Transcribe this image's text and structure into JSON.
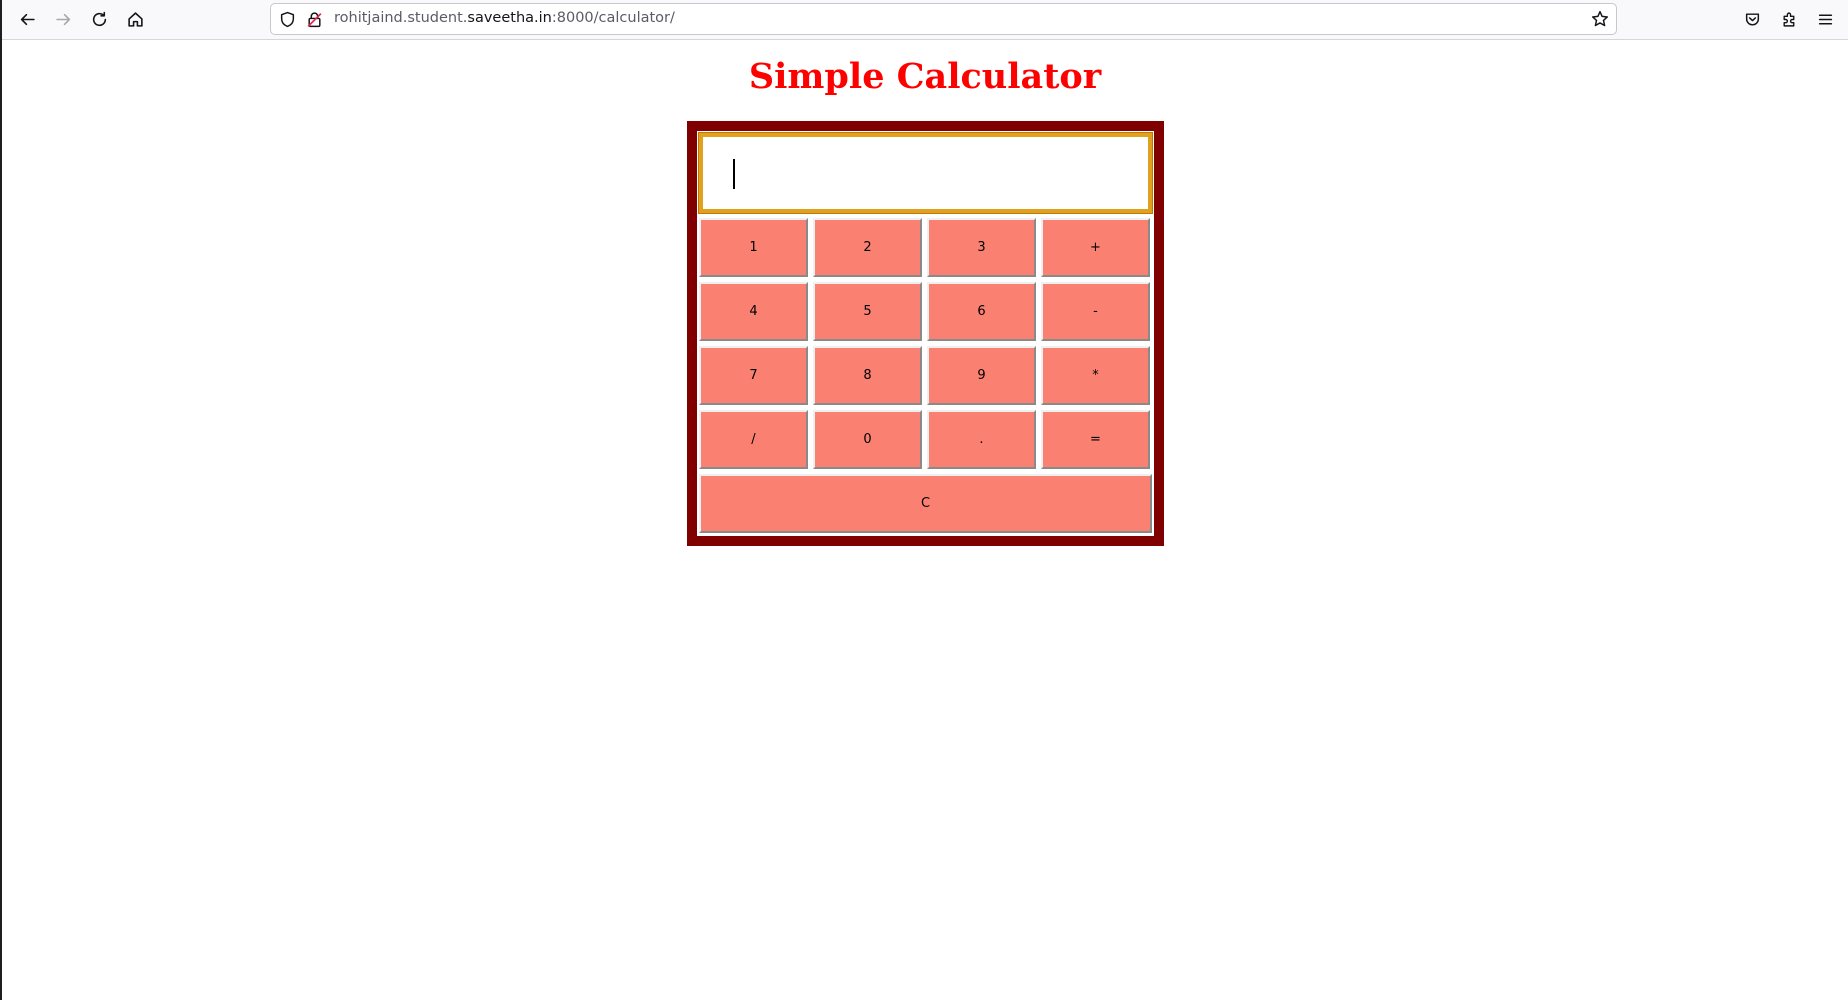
{
  "browser": {
    "url": {
      "prefix": "rohitjaind.student.",
      "domain": "saveetha.in",
      "suffix": ":8000/calculator/"
    },
    "icons": {
      "back": "back-arrow-icon",
      "forward": "forward-arrow-icon",
      "reload": "reload-icon",
      "home": "home-icon",
      "shield": "tracking-shield-icon",
      "lock": "insecure-lock-icon",
      "bookmark": "bookmark-star-icon",
      "pocket": "pocket-icon",
      "extensions": "extensions-puzzle-icon",
      "menu": "hamburger-menu-icon"
    }
  },
  "page": {
    "title": "Simple Calculator",
    "title_color": "#ff0000"
  },
  "calculator": {
    "display_value": "",
    "frame_color": "#800000",
    "key_color": "#fa8072",
    "display_border_color": "#e0a020",
    "keys": [
      [
        "1",
        "2",
        "3",
        "+"
      ],
      [
        "4",
        "5",
        "6",
        "-"
      ],
      [
        "7",
        "8",
        "9",
        "*"
      ],
      [
        "/",
        "0",
        ".",
        "="
      ]
    ],
    "clear_label": "C"
  }
}
